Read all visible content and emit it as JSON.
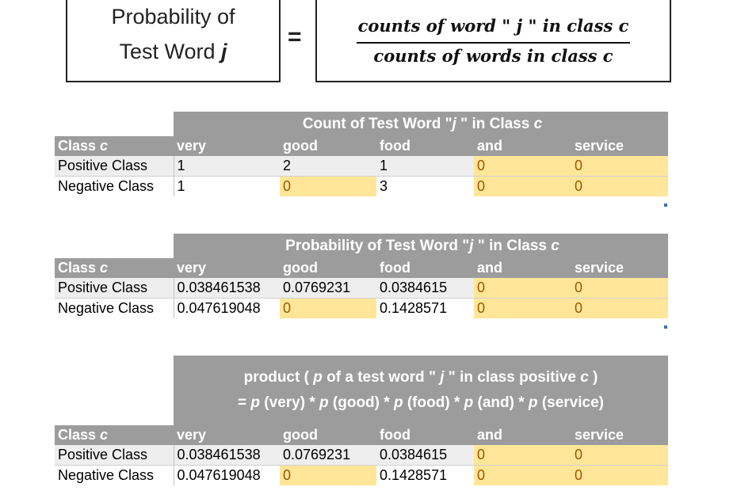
{
  "formula": {
    "left_line1": "Probability of",
    "left_line2": "Test Word",
    "left_var": "j",
    "equals": "=",
    "numerator": "counts of word \" j \" in class c",
    "denominator": "counts of words in class c"
  },
  "columns": [
    "Class c",
    "very",
    "good",
    "food",
    "and",
    "service"
  ],
  "table1": {
    "title_pre": "Count of Test Word \"",
    "title_var": "j",
    "title_mid": " \" in Class ",
    "title_c": "c",
    "rows": [
      {
        "label": "Positive Class",
        "values": [
          "1",
          "2",
          "1",
          "0",
          "0"
        ]
      },
      {
        "label": "Negative Class",
        "values": [
          "1",
          "0",
          "3",
          "0",
          "0"
        ]
      }
    ]
  },
  "table2": {
    "title_pre": "Probability of Test Word \"",
    "title_var": "j",
    "title_mid": " \" in Class ",
    "title_c": "c",
    "rows": [
      {
        "label": "Positive Class",
        "values": [
          "0.038461538",
          "0.0769231",
          "0.0384615",
          "0",
          "0"
        ]
      },
      {
        "label": "Negative Class",
        "values": [
          "0.047619048",
          "0",
          "0.1428571",
          "0",
          "0"
        ]
      }
    ]
  },
  "table3": {
    "title_line1": "product ( p of a test word \" j \" in class positive c )",
    "title_line2": "= p (very) * p (good) * p (food) * p (and) * p (service)",
    "rows": [
      {
        "label": "Positive Class",
        "values": [
          "0.038461538",
          "0.0769231",
          "0.0384615",
          "0",
          "0"
        ]
      },
      {
        "label": "Negative Class",
        "values": [
          "0.047619048",
          "0",
          "0.1428571",
          "0",
          "0"
        ]
      }
    ]
  }
}
